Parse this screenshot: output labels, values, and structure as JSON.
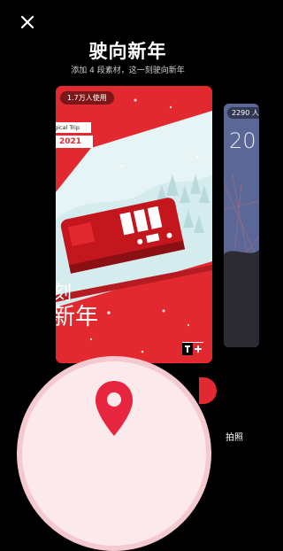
{
  "header": {
    "close_icon": "close-icon",
    "title": "驶向新年",
    "subtitle": "添加 4 段素材，这一刻驶向新年"
  },
  "main_card": {
    "usage_badge": "1.7万人使用",
    "trip_label": "gical Trip",
    "year_label": "2021",
    "line1": "刻",
    "line2": "新年",
    "colors": {
      "accent": "#e1292f",
      "snow": "#ffffff",
      "sky": "#e6f4f5"
    }
  },
  "side_card": {
    "usage_badge": "2290 人",
    "big_text": "20"
  },
  "bottom": {
    "shoot_label": "拍照",
    "center_icon": "location-pin-icon"
  }
}
